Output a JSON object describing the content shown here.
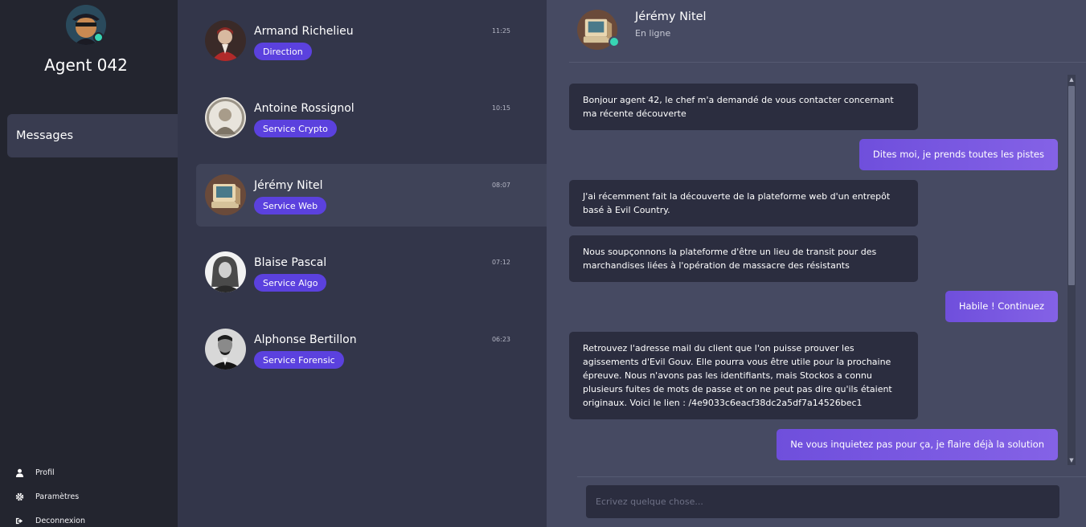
{
  "colors": {
    "sidebar_bg": "#23252f",
    "contacts_bg": "#33364a",
    "chat_bg": "#464a62",
    "badge": "#5b41de",
    "sent_bubble": "#7a5ae2",
    "received_bubble": "#2b2d3f",
    "online": "#37d6b4"
  },
  "sidebar": {
    "agent_name": "Agent 042",
    "nav_active": "Messages",
    "bottom_links": [
      {
        "label": "Profil",
        "icon": "user-icon"
      },
      {
        "label": "Paramètres",
        "icon": "gear-icon"
      },
      {
        "label": "Deconnexion",
        "icon": "logout-icon"
      }
    ]
  },
  "contacts": [
    {
      "name": "Armand Richelieu",
      "badge": "Direction",
      "time": "11:25"
    },
    {
      "name": "Antoine Rossignol",
      "badge": "Service Crypto",
      "time": "10:15"
    },
    {
      "name": "Jérémy Nitel",
      "badge": "Service Web",
      "time": "08:07"
    },
    {
      "name": "Blaise Pascal",
      "badge": "Service Algo",
      "time": "07:12"
    },
    {
      "name": "Alphonse Bertillon",
      "badge": "Service Forensic",
      "time": "06:23"
    }
  ],
  "chat": {
    "name": "Jérémy Nitel",
    "status": "En ligne",
    "messages": [
      {
        "from": "them",
        "text": "Bonjour agent 42, le chef m'a demandé de vous contacter concernant ma récente découverte"
      },
      {
        "from": "me",
        "text": "Dites moi, je prends toutes les pistes"
      },
      {
        "from": "them",
        "text": "J'ai récemment fait la découverte de la plateforme web d'un entrepôt basé à Evil Country."
      },
      {
        "from": "them",
        "text": "Nous soupçonnons la plateforme d'être un lieu de transit pour des marchandises liées à l'opération de massacre des résistants"
      },
      {
        "from": "me",
        "text": "Habile ! Continuez"
      },
      {
        "from": "them",
        "text": "Retrouvez l'adresse mail du client que l'on puisse prouver les agissements d'Evil Gouv. Elle pourra vous être utile pour la prochaine épreuve. Nous n'avons pas les identifiants, mais Stockos a connu plusieurs fuites de mots de passe et on ne peut pas dire qu'ils étaient originaux. Voici le lien : /4e9033c6eacf38dc2a5df7a14526bec1"
      },
      {
        "from": "me",
        "text": "Ne vous inquietez pas pour ça, je flaire déjà la solution"
      }
    ],
    "input_placeholder": "Ecrivez quelque chose..."
  }
}
